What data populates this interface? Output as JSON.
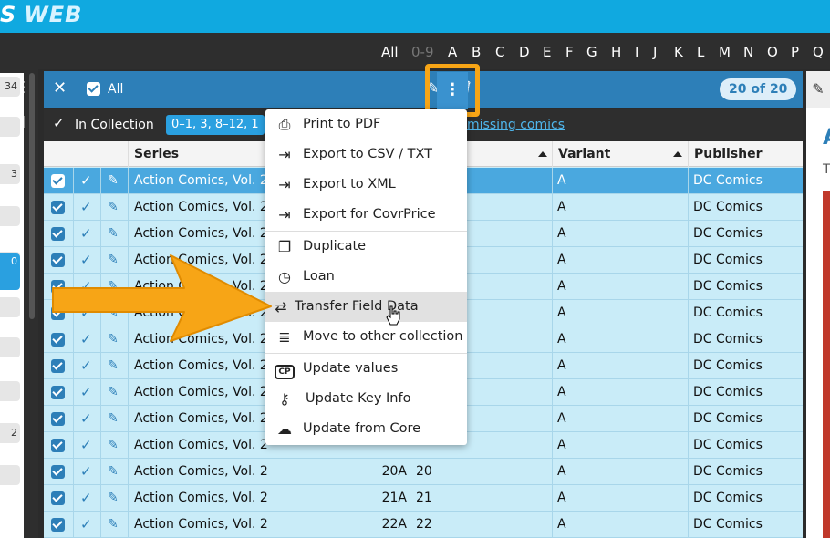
{
  "app": {
    "logo_s": "S",
    "logo_web": "WEB"
  },
  "alphabet": {
    "items": [
      "All",
      "0-9",
      "A",
      "B",
      "C",
      "D",
      "E",
      "F",
      "G",
      "H",
      "I",
      "J",
      "K",
      "L",
      "M",
      "N",
      "O",
      "P",
      "Q"
    ]
  },
  "left_panel": {
    "counts": [
      "34",
      "",
      "3",
      "",
      "",
      "0",
      "",
      "",
      "",
      "",
      "",
      "",
      "",
      "2",
      ""
    ]
  },
  "selection_bar": {
    "all_label": "All",
    "count": "20 of 20"
  },
  "filter_bar": {
    "label": "In Collection",
    "chip": "0–1, 3, 8–12, 1",
    "missing_link": "missing comics"
  },
  "grid": {
    "columns": {
      "series": "Series",
      "variant": "Variant",
      "publisher": "Publisher"
    },
    "rows": [
      {
        "series": "Action Comics, Vol. 2",
        "issue": "",
        "num": "",
        "variant": "A",
        "publisher": "DC Comics"
      },
      {
        "series": "Action Comics, Vol. 2",
        "issue": "",
        "num": "",
        "variant": "A",
        "publisher": "DC Comics"
      },
      {
        "series": "Action Comics, Vol. 2",
        "issue": "",
        "num": "",
        "variant": "A",
        "publisher": "DC Comics"
      },
      {
        "series": "Action Comics, Vol. 2",
        "issue": "",
        "num": "",
        "variant": "A",
        "publisher": "DC Comics"
      },
      {
        "series": "Action Comics, Vol. 2",
        "issue": "",
        "num": "",
        "variant": "A",
        "publisher": "DC Comics"
      },
      {
        "series": "Action Comics, Vol. 2",
        "issue": "",
        "num": "",
        "variant": "A",
        "publisher": "DC Comics"
      },
      {
        "series": "Action Comics, Vol. 2",
        "issue": "",
        "num": "",
        "variant": "A",
        "publisher": "DC Comics"
      },
      {
        "series": "Action Comics, Vol. 2",
        "issue": "",
        "num": "",
        "variant": "A",
        "publisher": "DC Comics"
      },
      {
        "series": "Action Comics, Vol. 2",
        "issue": "",
        "num": "",
        "variant": "A",
        "publisher": "DC Comics"
      },
      {
        "series": "Action Comics, Vol. 2",
        "issue": "",
        "num": "",
        "variant": "A",
        "publisher": "DC Comics"
      },
      {
        "series": "Action Comics, Vol. 2",
        "issue": "",
        "num": "",
        "variant": "A",
        "publisher": "DC Comics"
      },
      {
        "series": "Action Comics, Vol. 2",
        "issue": "20A",
        "num": "20",
        "variant": "A",
        "publisher": "DC Comics"
      },
      {
        "series": "Action Comics, Vol. 2",
        "issue": "21A",
        "num": "21",
        "variant": "A",
        "publisher": "DC Comics"
      },
      {
        "series": "Action Comics, Vol. 2",
        "issue": "22A",
        "num": "22",
        "variant": "A",
        "publisher": "DC Comics"
      },
      {
        "series": "Action Comics, Vol. 2",
        "issue": "23A",
        "num": "23",
        "variant": "A",
        "publisher": "DC Comics"
      }
    ]
  },
  "menu": {
    "items": [
      {
        "label": "Print to PDF",
        "icon": "printer-icon"
      },
      {
        "label": "Export to CSV / TXT",
        "icon": "export-icon"
      },
      {
        "label": "Export to XML",
        "icon": "export-icon"
      },
      {
        "label": "Export for CovrPrice",
        "icon": "export-icon"
      },
      {
        "label": "Duplicate",
        "icon": "duplicate-icon"
      },
      {
        "label": "Loan",
        "icon": "clock-icon"
      },
      {
        "label": "Transfer Field Data",
        "icon": "transfer-icon"
      },
      {
        "label": "Move to other collection",
        "icon": "database-icon"
      },
      {
        "label": "Update values",
        "icon": "cp-icon"
      },
      {
        "label": "Update Key Info",
        "icon": "key-icon"
      },
      {
        "label": "Update from Core",
        "icon": "cloud-download-icon"
      }
    ]
  },
  "right_pane": {
    "letter": "A",
    "t": "T"
  },
  "colors": {
    "accent": "#10a9e0",
    "highlight_orange": "#f7a516",
    "selection_blue": "#2d7fb8"
  }
}
